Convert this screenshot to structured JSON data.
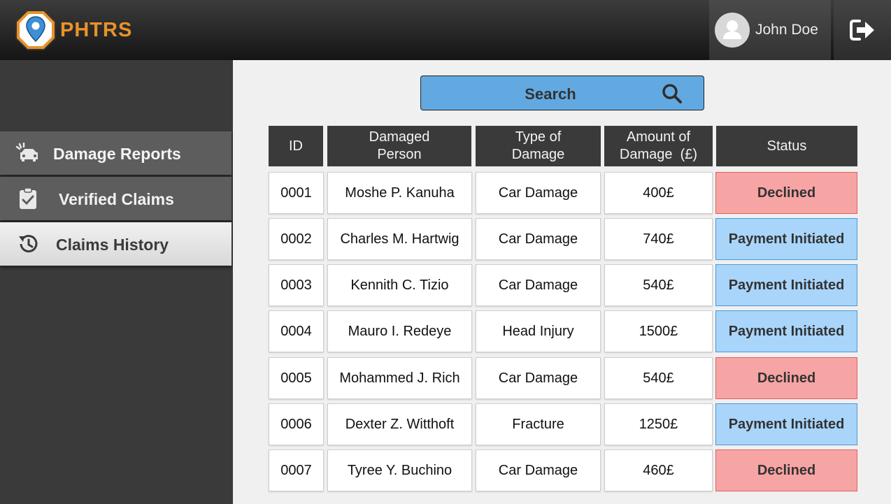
{
  "header": {
    "brand": "PHTRS",
    "user_name": "John Doe",
    "icons": {
      "logo": "map-pin-badge-icon",
      "avatar": "user-avatar-icon",
      "logout": "logout-icon"
    },
    "colors": {
      "brand": "#e8922a",
      "topbar": "#1e1e1e"
    }
  },
  "sidebar": {
    "items": [
      {
        "label": "Damage Reports",
        "icon": "car-crash-icon",
        "active": false
      },
      {
        "label": "Verified Claims",
        "icon": "clipboard-check-icon",
        "active": false
      },
      {
        "label": "Claims History",
        "icon": "history-icon",
        "active": true
      }
    ]
  },
  "search": {
    "label": "Search",
    "icon": "search-icon",
    "color": "#62a9e1"
  },
  "table": {
    "headers": {
      "id": "ID",
      "person": [
        "Damaged",
        "Person"
      ],
      "type": [
        "Type of",
        "Damage"
      ],
      "amount": [
        "Amount of",
        "Damage  (£)"
      ],
      "status": "Status"
    },
    "rows": [
      {
        "id": "0001",
        "person": "Moshe P. Kanuha",
        "type": "Car Damage",
        "amount": "400£",
        "status": "Declined"
      },
      {
        "id": "0002",
        "person": "Charles M. Hartwig",
        "type": "Car Damage",
        "amount": "740£",
        "status": "Payment Initiated"
      },
      {
        "id": "0003",
        "person": "Kennith C. Tizio",
        "type": "Car Damage",
        "amount": "540£",
        "status": "Payment Initiated"
      },
      {
        "id": "0004",
        "person": "Mauro I. Redeye",
        "type": "Head Injury",
        "amount": "1500£",
        "status": "Payment Initiated"
      },
      {
        "id": "0005",
        "person": "Mohammed J. Rich",
        "type": "Car Damage",
        "amount": "540£",
        "status": "Declined"
      },
      {
        "id": "0006",
        "person": "Dexter Z. Witthoft",
        "type": "Fracture",
        "amount": "1250£",
        "status": "Payment Initiated"
      },
      {
        "id": "0007",
        "person": "Tyree Y. Buchino",
        "type": "Car Damage",
        "amount": "460£",
        "status": "Declined"
      }
    ],
    "status_colors": {
      "Declined": "#f7a4a4",
      "Payment Initiated": "#a9d5fb"
    }
  }
}
